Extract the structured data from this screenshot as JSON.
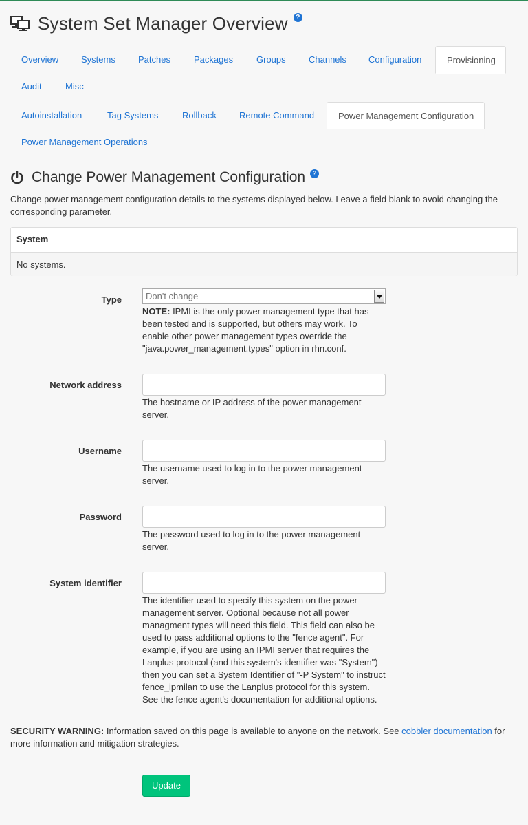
{
  "header": {
    "title": "System Set Manager Overview",
    "help_glyph": "?",
    "icon": "system-set-icon"
  },
  "tabs_primary": [
    {
      "label": "Overview",
      "active": false
    },
    {
      "label": "Systems",
      "active": false
    },
    {
      "label": "Patches",
      "active": false
    },
    {
      "label": "Packages",
      "active": false
    },
    {
      "label": "Groups",
      "active": false
    },
    {
      "label": "Channels",
      "active": false
    },
    {
      "label": "Configuration",
      "active": false
    },
    {
      "label": "Provisioning",
      "active": true
    },
    {
      "label": "Audit",
      "active": false
    },
    {
      "label": "Misc",
      "active": false
    }
  ],
  "tabs_secondary": [
    {
      "label": "Autoinstallation",
      "active": false
    },
    {
      "label": "Tag Systems",
      "active": false
    },
    {
      "label": "Rollback",
      "active": false
    },
    {
      "label": "Remote Command",
      "active": false
    },
    {
      "label": "Power Management Configuration",
      "active": true
    },
    {
      "label": "Power Management Operations",
      "active": false
    }
  ],
  "section": {
    "title": "Change Power Management Configuration",
    "icon": "power-icon",
    "description": "Change power management configuration details to the systems displayed below. Leave a field blank to avoid changing the corresponding parameter."
  },
  "systems_table": {
    "header": "System",
    "empty_text": "No systems."
  },
  "form": {
    "type": {
      "label": "Type",
      "selected": "Don't change",
      "note_strong": "NOTE:",
      "note": " IPMI is the only power management type that has been tested and is supported, but others may work. To enable other power management types override the \"java.power_management.types\" option in rhn.conf."
    },
    "network_address": {
      "label": "Network address",
      "value": "",
      "help": "The hostname or IP address of the power management server."
    },
    "username": {
      "label": "Username",
      "value": "",
      "help": "The username used to log in to the power management server."
    },
    "password": {
      "label": "Password",
      "value": "",
      "help": "The password used to log in to the power management server."
    },
    "system_identifier": {
      "label": "System identifier",
      "value": "",
      "help": "The identifier used to specify this system on the power management server. Optional because not all power managment types will need this field. This field can also be used to pass additional options to the \"fence agent\". For example, if you are using an IPMI server that requires the Lanplus protocol (and this system's identifier was \"System\") then you can set a System Identifier of \"-P System\" to instruct fence_ipmilan to use the Lanplus protocol for this system. See the fence agent's documentation for additional options."
    }
  },
  "warning": {
    "strong": "SECURITY WARNING:",
    "text_before": " Information saved on this page is available to anyone on the network. See ",
    "link": "cobbler documentation",
    "text_after": " for more information and mitigation strategies."
  },
  "update_button": "Update",
  "colors": {
    "link": "#1f74d4",
    "button": "#00c47c",
    "top_border": "#2e8b57"
  }
}
